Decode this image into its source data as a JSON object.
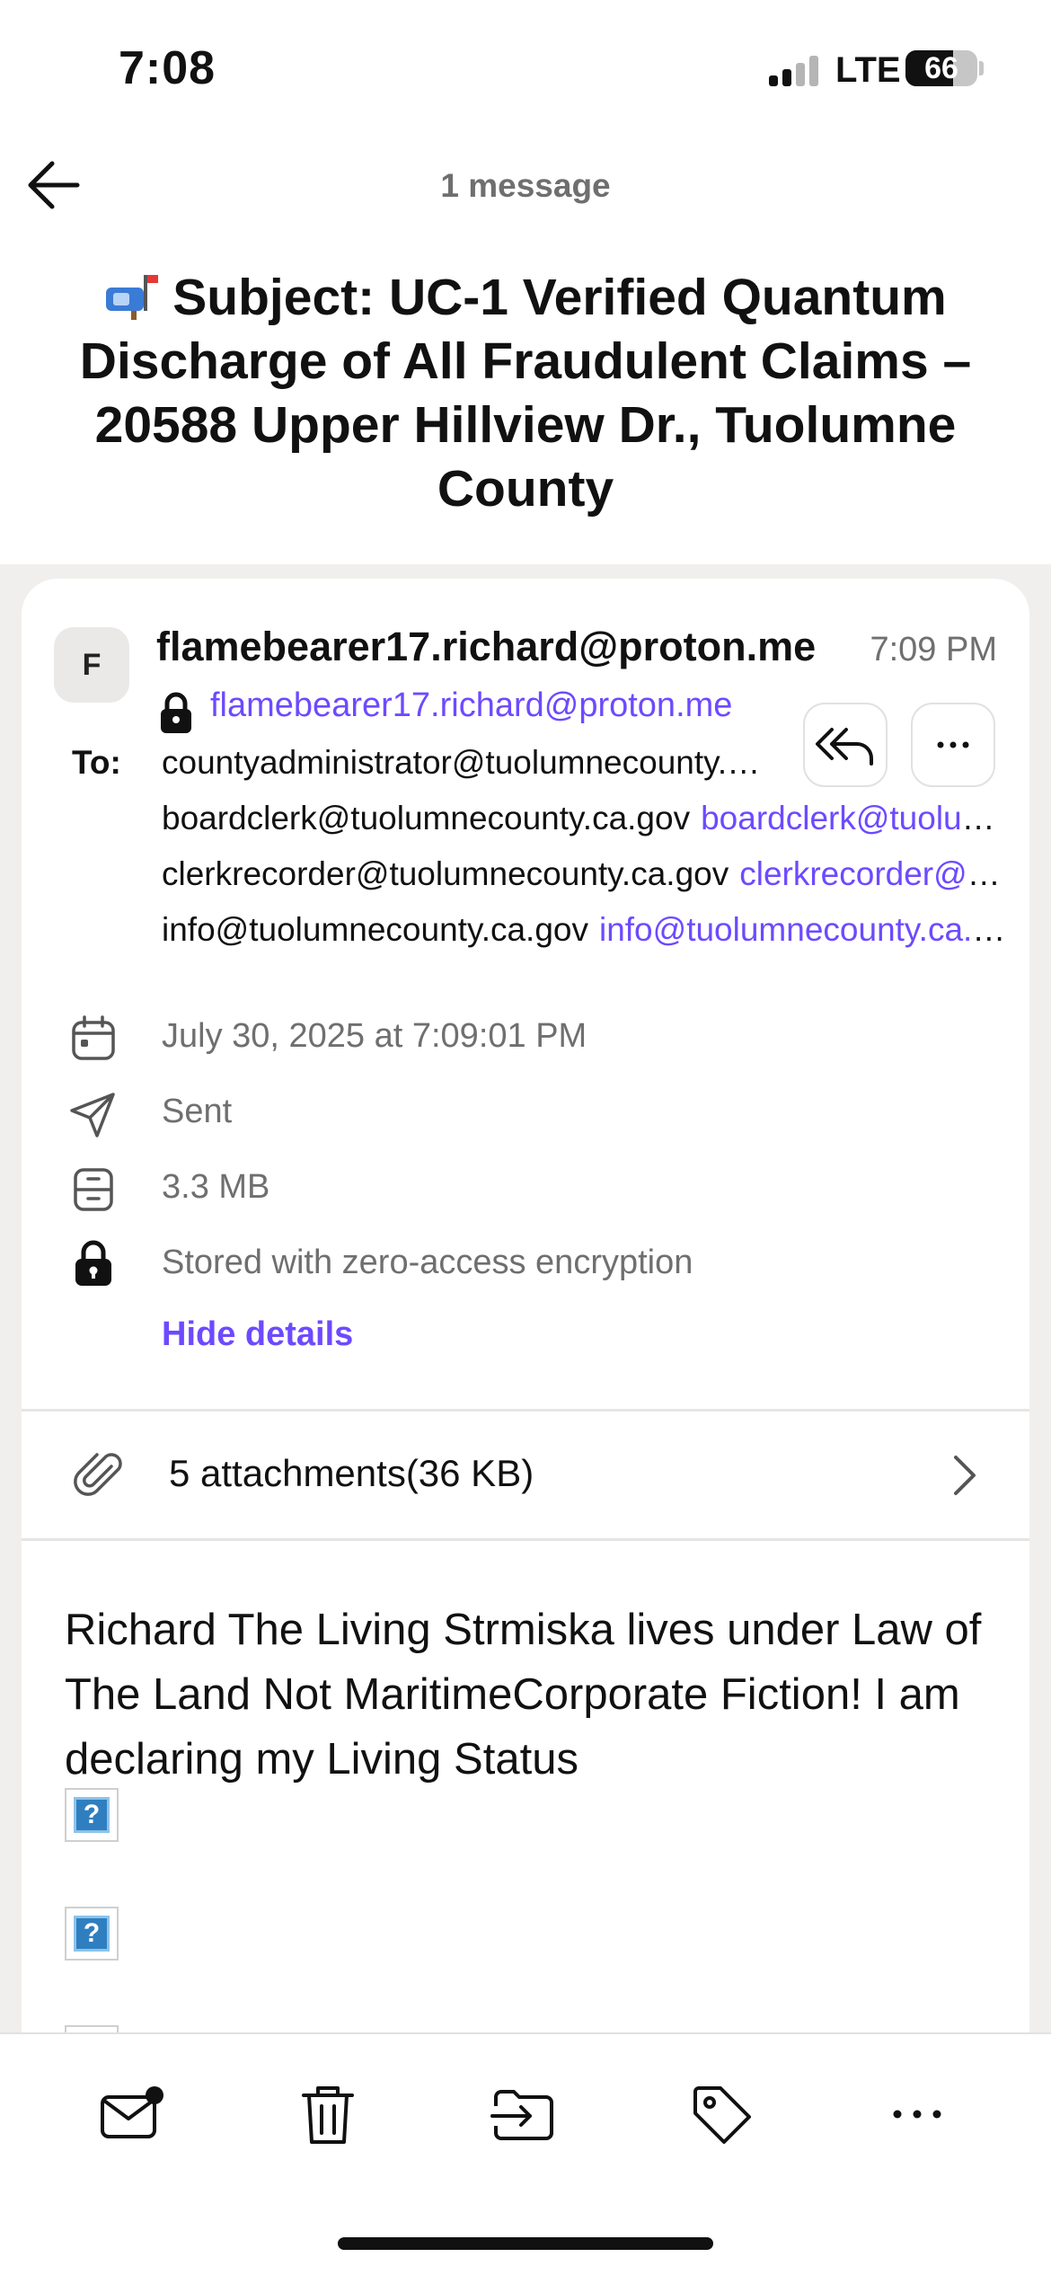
{
  "status_bar": {
    "time": "7:08",
    "network": "LTE",
    "battery": "66",
    "battery_level": 0.66
  },
  "header": {
    "back_icon": "arrow-left-icon",
    "message_count": "1 message",
    "subject_icon": "mailbox-icon",
    "subject": "Subject: UC-1 Verified Quantum Discharge of All Fraudulent Claims – 20588 Upper Hillview Dr., Tuolumne County"
  },
  "message": {
    "avatar_initial": "F",
    "sender_name": "flamebearer17.richard@proton.me",
    "time": "7:09 PM",
    "sender_address": "flamebearer17.richard@proton.me",
    "to_label": "To:",
    "recipients": [
      {
        "name": "countyadministrator@tuolumnecounty.ca.gov",
        "address": ""
      },
      {
        "name": "boardclerk@tuolumnecounty.ca.gov",
        "address": "boardclerk@tuolumnecounty.ca.gov"
      },
      {
        "name": "clerkrecorder@tuolumnecounty.ca.gov",
        "address": "clerkrecorder@tuolumnecounty.ca.gov"
      },
      {
        "name": "info@tuolumnecounty.ca.gov",
        "address": "info@tuolumnecounty.ca.gov"
      }
    ],
    "details": {
      "date": "July 30, 2025 at 7:09:01 PM",
      "folder": "Sent",
      "size": "3.3 MB",
      "encryption": "Stored with zero-access encryption",
      "hide_details": "Hide details"
    },
    "attachments_label": "5 attachments(36 KB)",
    "body": "Richard The Living Strmiska lives under Law of The Land Not MaritimeCorporate Fiction!  I am declaring my Living Status",
    "broken_image_glyph": "?"
  },
  "toolbar": {
    "icons": [
      "mark-unread-icon",
      "trash-icon",
      "move-to-folder-icon",
      "label-icon",
      "more-icon"
    ]
  },
  "colors": {
    "accent": "#6d4aff",
    "muted_text": "#6f6f6f",
    "background": "#f1efed"
  }
}
